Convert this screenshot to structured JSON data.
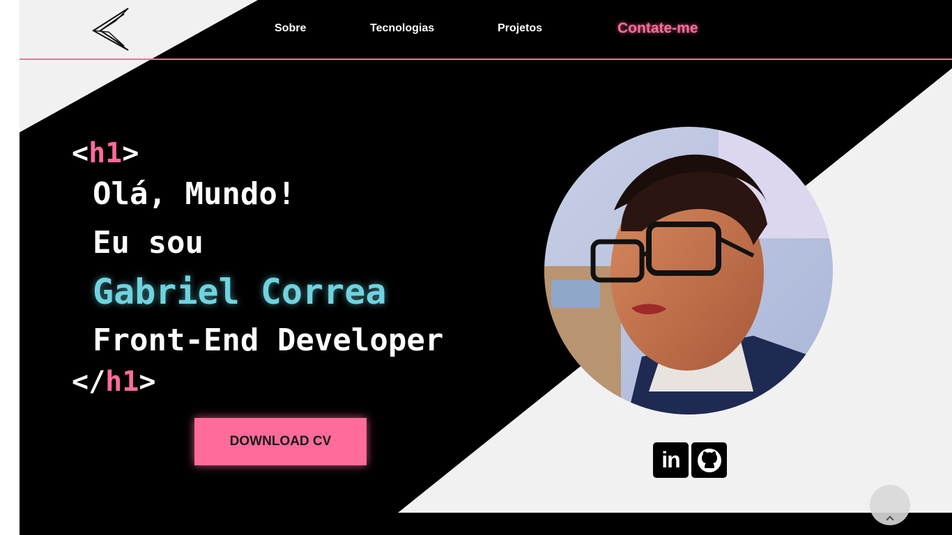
{
  "nav": {
    "items": [
      "Sobre",
      "Tecnologias",
      "Projetos"
    ],
    "contact": "Contate-me"
  },
  "hero": {
    "open_bracket": "<",
    "tag": "h1",
    "close_bracket": ">",
    "close_open_bracket": "</",
    "greeting": "Olá, Mundo!",
    "intro": "Eu sou",
    "name": "Gabriel Correa",
    "role": "Front-End Developer"
  },
  "cta": {
    "download_label": "DOWNLOAD CV"
  },
  "socials": {
    "linkedin_label": "in",
    "icons": [
      "linkedin-icon",
      "github-icon"
    ]
  },
  "colors": {
    "background": "#000000",
    "accent_pink": "#ff6b9a",
    "accent_cyan": "#6fd3e0",
    "light_shape": "#f1f1f1"
  }
}
